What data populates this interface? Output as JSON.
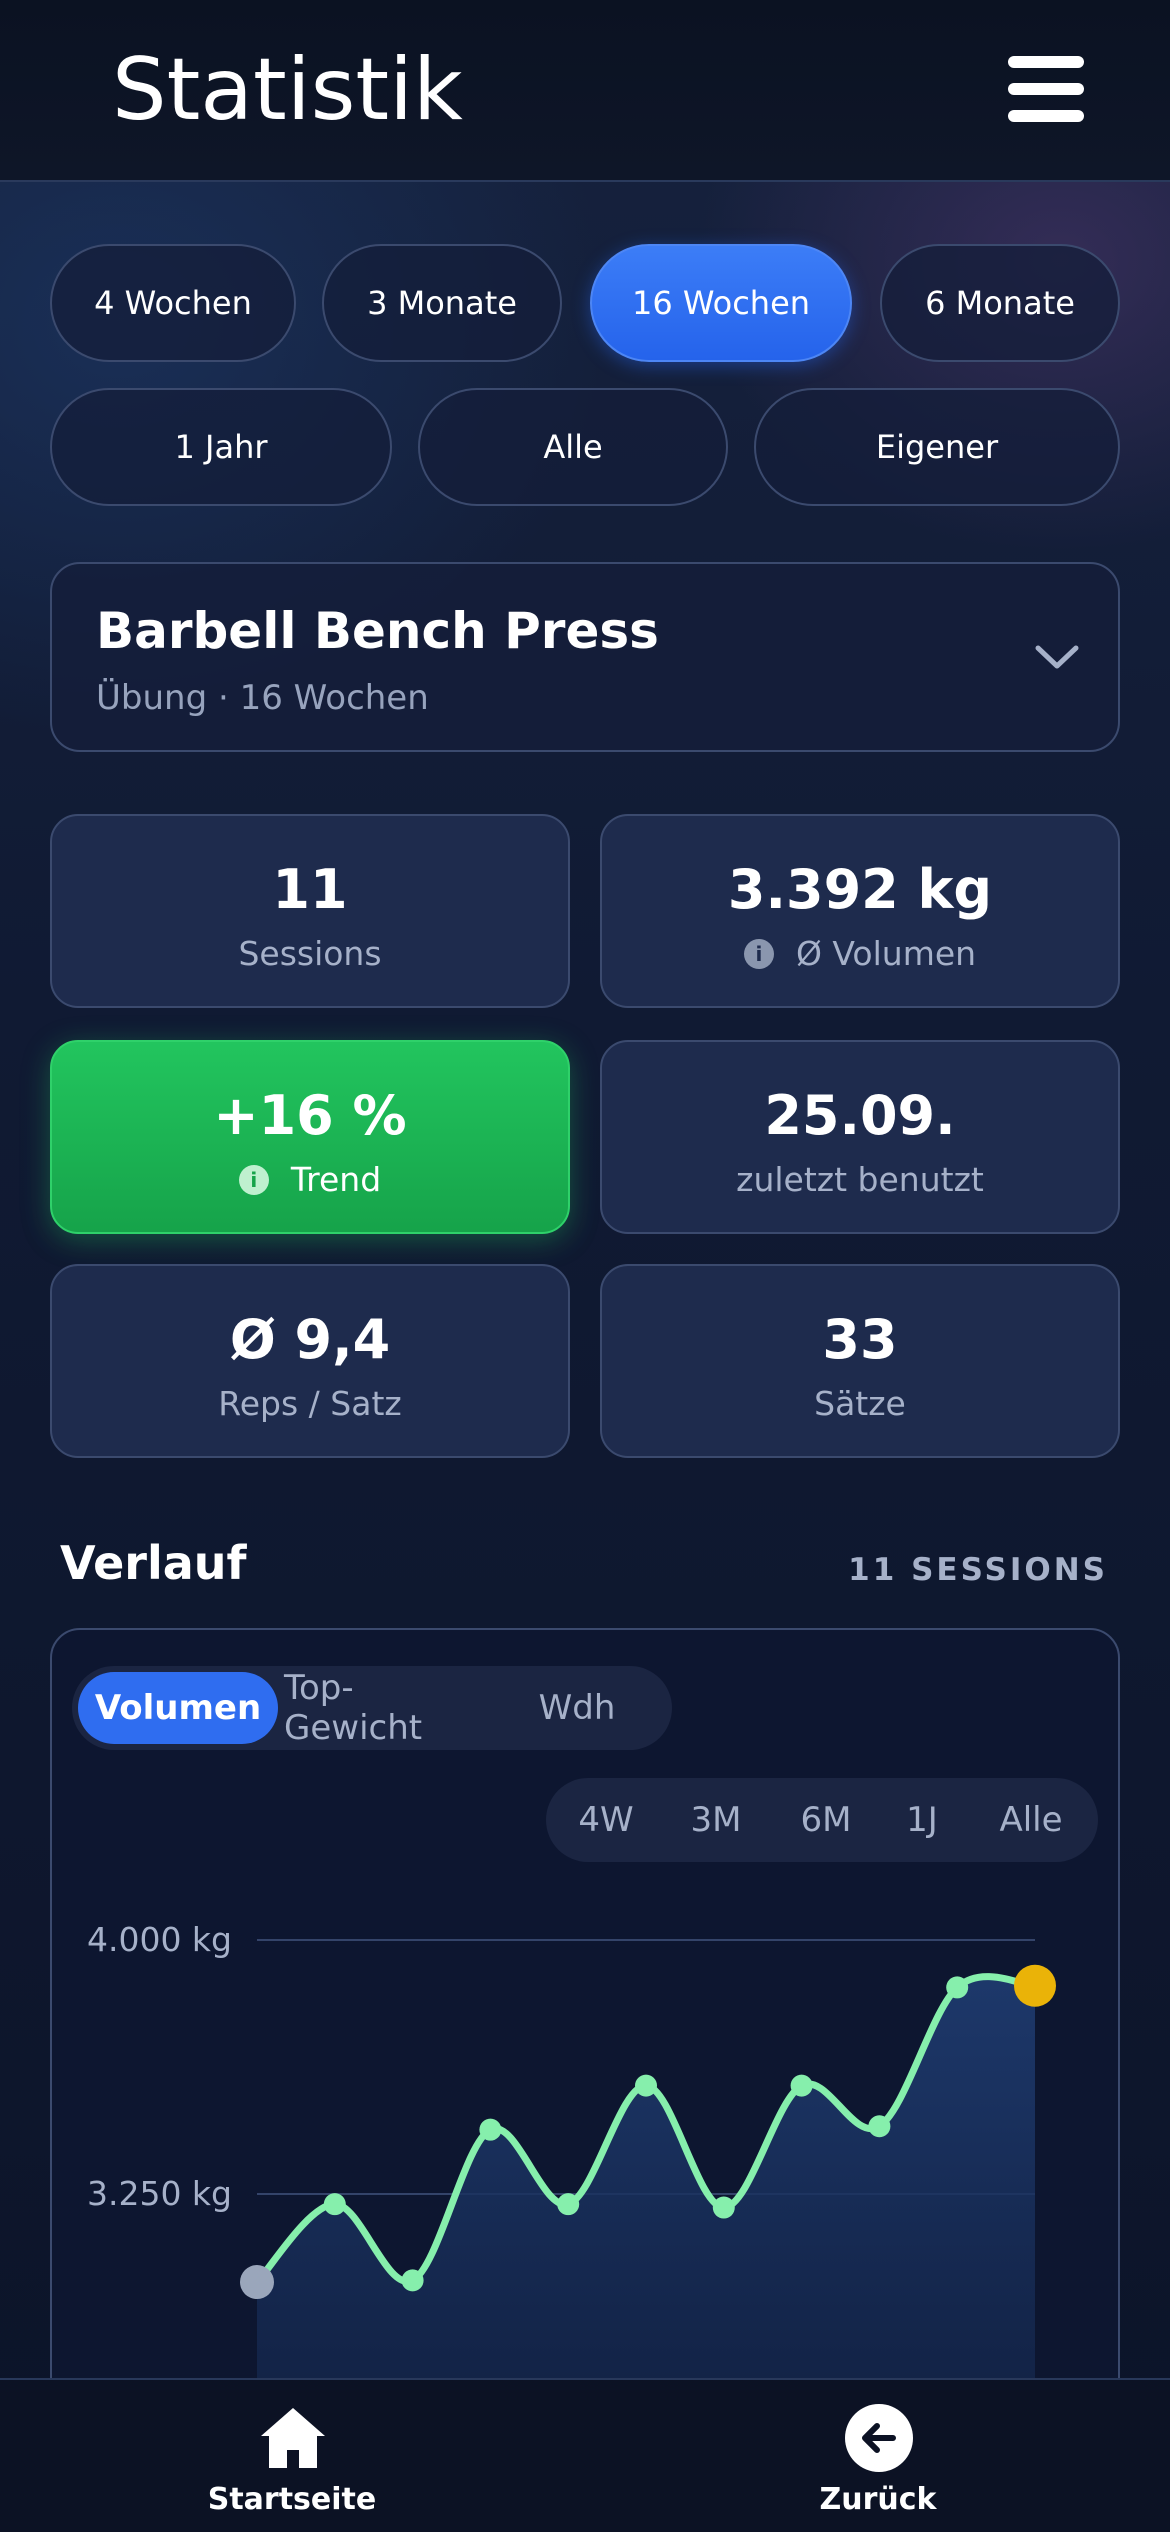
{
  "header": {
    "title": "Statistik",
    "menu_icon": "hamburger-menu-icon"
  },
  "ranges": [
    {
      "label": "4 Wochen",
      "active": false
    },
    {
      "label": "3 Monate",
      "active": false
    },
    {
      "label": "16 Wochen",
      "active": true
    },
    {
      "label": "6 Monate",
      "active": false
    },
    {
      "label": "1 Jahr",
      "active": false
    },
    {
      "label": "Alle",
      "active": false
    },
    {
      "label": "Eigener",
      "active": false
    }
  ],
  "exercise": {
    "name": "Barbell Bench Press",
    "subtitle": "Übung · 16 Wochen"
  },
  "stats": [
    {
      "value": "11",
      "label": "Sessions"
    },
    {
      "value": "3.392 kg",
      "label": "Ø Volumen",
      "info": true
    },
    {
      "value": "+16 %",
      "label": "Trend",
      "info": true,
      "highlight": true
    },
    {
      "value": "25.09.",
      "label": "zuletzt benutzt"
    },
    {
      "value": "Ø 9,4",
      "label": "Reps / Satz"
    },
    {
      "value": "33",
      "label": "Sätze"
    }
  ],
  "history": {
    "title": "Verlauf",
    "count": "11 SESSIONS",
    "metric_tabs": [
      {
        "label": "Volumen",
        "active": true
      },
      {
        "label": "Top-Gewicht",
        "active": false
      },
      {
        "label": "Wdh",
        "active": false
      }
    ],
    "range_tabs": [
      "4W",
      "3M",
      "6M",
      "1J",
      "Alle"
    ]
  },
  "chart_data": {
    "type": "area",
    "y_tick_labels": [
      "4.000 kg",
      "3.250 kg"
    ],
    "y_ticks": [
      4000,
      3250
    ],
    "x": [
      1,
      2,
      3,
      4,
      5,
      6,
      7,
      8,
      9,
      10,
      11
    ],
    "values": [
      2990,
      3220,
      2995,
      3440,
      3220,
      3570,
      3210,
      3570,
      3450,
      3860,
      3865
    ],
    "ylim": [
      2690,
      4145
    ],
    "grid": true,
    "colors": {
      "line": "#86efac",
      "first_point": "#9aa6bb",
      "last_point": "#eab308",
      "fill": "#1e3a6e"
    }
  },
  "bottom_nav": [
    {
      "label": "Startseite",
      "icon": "home-icon"
    },
    {
      "label": "Zurück",
      "icon": "back-arrow-icon"
    }
  ]
}
